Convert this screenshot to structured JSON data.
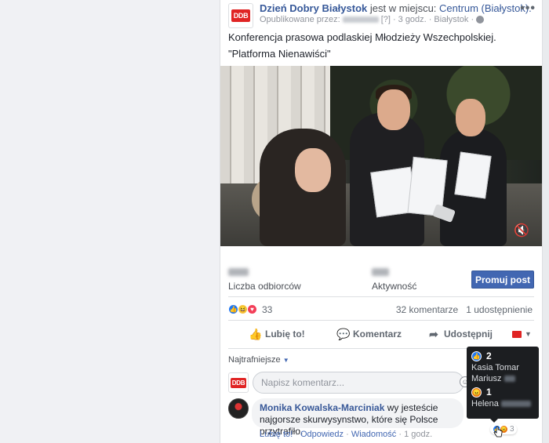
{
  "post": {
    "page_name": "Dzień Dobry Białystok",
    "location_prefix": "jest w miejscu:",
    "location": "Centrum (Białystok).",
    "published_by": "Opublikowane przez:",
    "published_by_extra": "[?]",
    "time": "3 godz.",
    "place": "Białystok",
    "logo_text": "DDB",
    "more_icon": "more-dots-icon",
    "text_line1": "Konferencja prasowa podlaskiej Młodzieży Wszechpolskiej.",
    "text_line2": "\"Platforma Nienawiści\""
  },
  "stats": {
    "reach_label": "Liczba odbiorców",
    "engagement_label": "Aktywność",
    "promote_label": "Promuj post"
  },
  "reactions": {
    "count": "33",
    "comments": "32 komentarze",
    "shares": "1 udostępnienie"
  },
  "actions": {
    "like": "Lubię to!",
    "comment": "Komentarz",
    "share": "Udostępnij"
  },
  "comments": {
    "sort_label": "Najtrafniejsze",
    "input_placeholder": "Napisz komentarz...",
    "items": [
      {
        "author": "Monika Kowalska-Marciniak",
        "text": "wy jesteście najgorsze skurwysynstwo, które się Polsce przytrafiło.",
        "like_link": "Lubię to!",
        "reply_link": "Odpowiedz",
        "message_link": "Wiadomość",
        "time": "1 godz.",
        "reaction_count": "3"
      }
    ]
  },
  "tooltip": {
    "like_count": "2",
    "like_names": [
      "Kasia Tomar",
      "Mariusz"
    ],
    "angry_count": "1",
    "angry_names": [
      "Helena"
    ]
  },
  "colors": {
    "facebook_blue": "#4267b2",
    "link_blue": "#365899",
    "brand_red": "#e02424"
  }
}
